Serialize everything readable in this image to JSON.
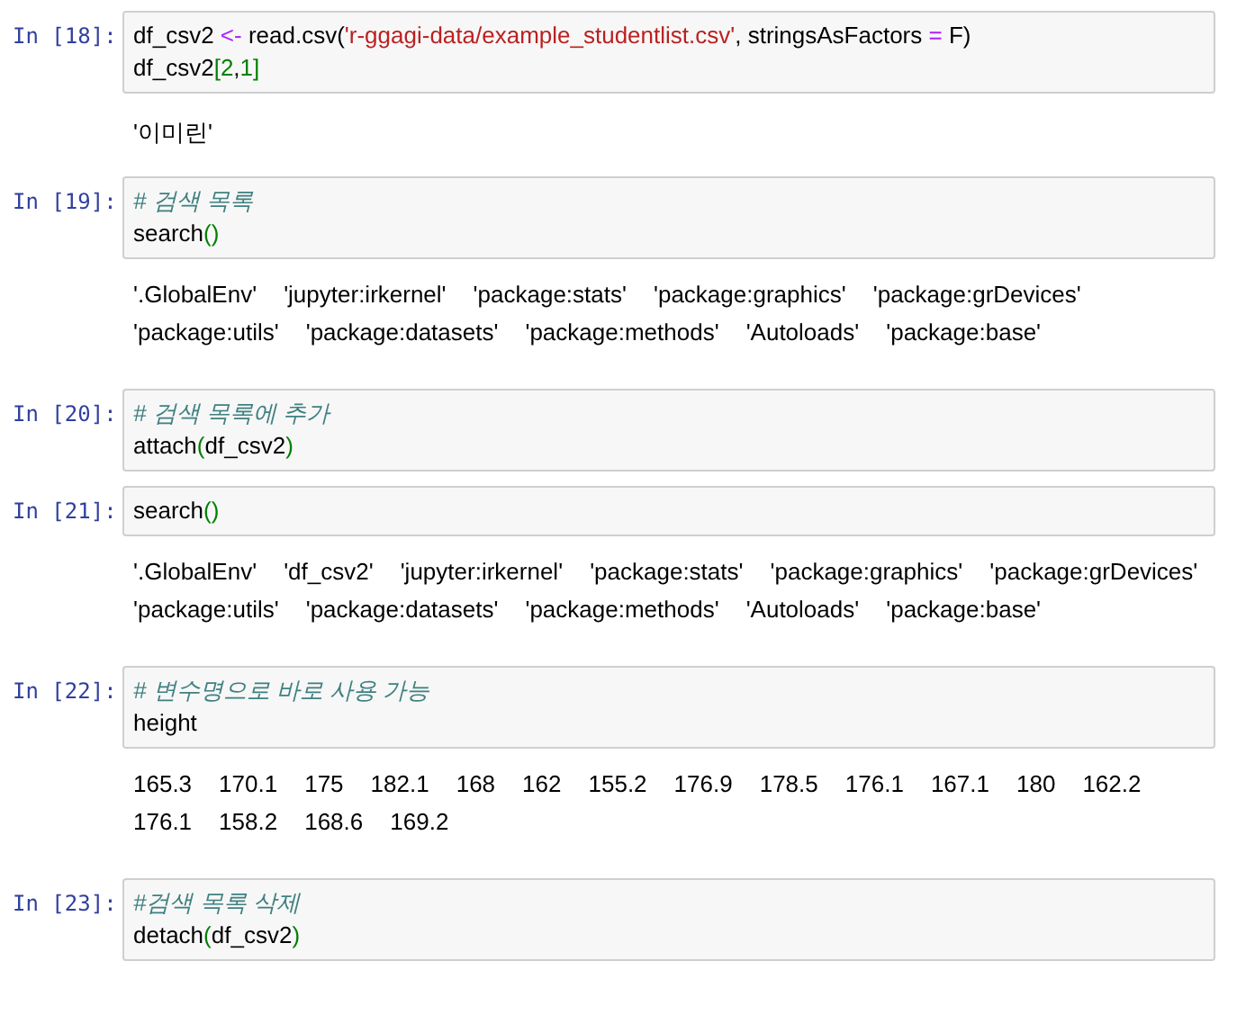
{
  "cells": [
    {
      "prompt": "In [18]:",
      "lines": [
        [
          {
            "kind": "name",
            "text": "df_csv2 "
          },
          {
            "kind": "operator",
            "text": "<-"
          },
          {
            "kind": "name",
            "text": " read.csv("
          },
          {
            "kind": "string",
            "text": "'r-ggagi-data/example_studentlist.csv'"
          },
          {
            "kind": "name",
            "text": ", stringsAsFactors "
          },
          {
            "kind": "operator",
            "text": "="
          },
          {
            "kind": "name",
            "text": " F)"
          }
        ],
        [
          {
            "kind": "name",
            "text": "df_csv2"
          },
          {
            "kind": "bracket",
            "text": "["
          },
          {
            "kind": "number",
            "text": "2"
          },
          {
            "kind": "name",
            "text": ","
          },
          {
            "kind": "number",
            "text": "1"
          },
          {
            "kind": "bracket",
            "text": "]"
          }
        ]
      ],
      "output": {
        "kind": "scalar",
        "text": "'이미린'"
      }
    },
    {
      "prompt": "In [19]:",
      "lines": [
        [
          {
            "kind": "comment",
            "text": "# 검색 목록"
          }
        ],
        [
          {
            "kind": "name",
            "text": "search"
          },
          {
            "kind": "bracket",
            "text": "()"
          }
        ]
      ],
      "output": {
        "kind": "vector",
        "items": [
          "'.GlobalEnv'",
          "'jupyter:irkernel'",
          "'package:stats'",
          "'package:graphics'",
          "'package:grDevices'",
          "'package:utils'",
          "'package:datasets'",
          "'package:methods'",
          "'Autoloads'",
          "'package:base'"
        ]
      }
    },
    {
      "prompt": "In [20]:",
      "lines": [
        [
          {
            "kind": "comment",
            "text": "# 검색 목록에 추가"
          }
        ],
        [
          {
            "kind": "name",
            "text": "attach"
          },
          {
            "kind": "bracket",
            "text": "("
          },
          {
            "kind": "name",
            "text": "df_csv2"
          },
          {
            "kind": "bracket",
            "text": ")"
          }
        ]
      ]
    },
    {
      "prompt": "In [21]:",
      "lines": [
        [
          {
            "kind": "name",
            "text": "search"
          },
          {
            "kind": "bracket",
            "text": "()"
          }
        ]
      ],
      "output": {
        "kind": "vector",
        "items": [
          "'.GlobalEnv'",
          "'df_csv2'",
          "'jupyter:irkernel'",
          "'package:stats'",
          "'package:graphics'",
          "'package:grDevices'",
          "'package:utils'",
          "'package:datasets'",
          "'package:methods'",
          "'Autoloads'",
          "'package:base'"
        ]
      }
    },
    {
      "prompt": "In [22]:",
      "lines": [
        [
          {
            "kind": "comment",
            "text": "# 변수명으로 바로 사용 가능"
          }
        ],
        [
          {
            "kind": "name",
            "text": "height"
          }
        ]
      ],
      "output": {
        "kind": "vector",
        "items": [
          "165.3",
          "170.1",
          "175",
          "182.1",
          "168",
          "162",
          "155.2",
          "176.9",
          "178.5",
          "176.1",
          "167.1",
          "180",
          "162.2",
          "176.1",
          "158.2",
          "168.6",
          "169.2"
        ]
      }
    },
    {
      "prompt": "In [23]:",
      "lines": [
        [
          {
            "kind": "comment",
            "text": "#검색 목록 삭제"
          }
        ],
        [
          {
            "kind": "name",
            "text": "detach"
          },
          {
            "kind": "bracket",
            "text": "("
          },
          {
            "kind": "name",
            "text": "df_csv2"
          },
          {
            "kind": "bracket",
            "text": ")"
          }
        ]
      ]
    }
  ]
}
